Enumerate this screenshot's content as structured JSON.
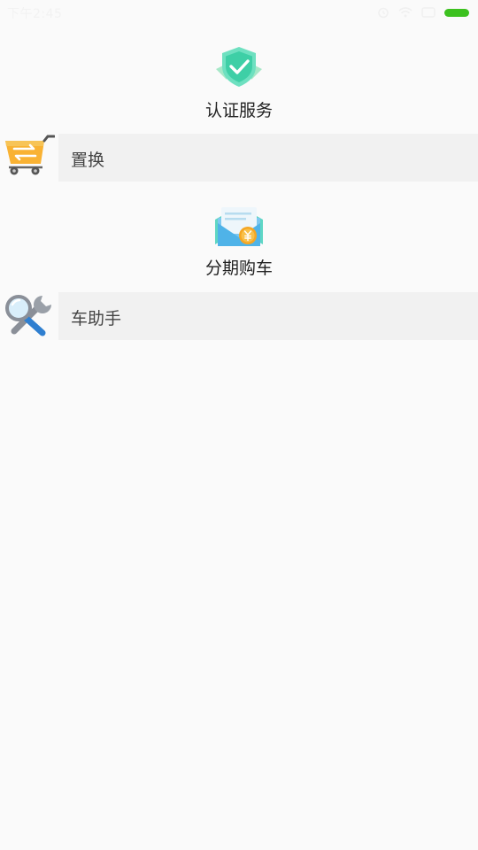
{
  "status_bar": {
    "time": "下午2:45",
    "icons": [
      "alarm-icon",
      "wifi-icon",
      "message-icon",
      "battery-icon"
    ],
    "battery_color": "#3cc11f"
  },
  "sections": [
    {
      "title": "认证服务",
      "icon": "shield-check-icon",
      "color": "#3ed6b0"
    },
    {
      "title": "分期购车",
      "icon": "envelope-coin-icon",
      "color": "#f5a623"
    }
  ],
  "rows": [
    {
      "label": "置换",
      "icon": "cart-exchange-icon"
    },
    {
      "label": "车助手",
      "icon": "wrench-magnifier-icon"
    }
  ]
}
